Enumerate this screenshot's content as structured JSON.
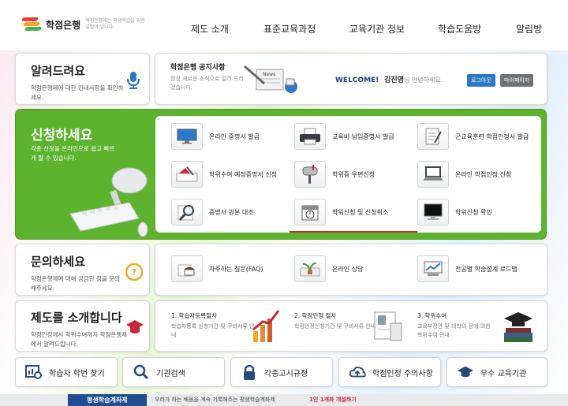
{
  "brand": {
    "name": "학점은행",
    "tagline": "학점은행제는 평생학습을 위한 길잡이 입니다."
  },
  "nav": [
    "제도 소개",
    "표준교육과정",
    "교육기관 정보",
    "학습도움방",
    "알림방"
  ],
  "notice_card": {
    "title": "알려드려요",
    "desc": "학점은행제에 대한 안내사항을 확인하세요."
  },
  "announce": {
    "title": "학점은행 공지사항",
    "desc": "항상 새로운 소식으로 알려 드리겠습니다.",
    "news_tag": "News"
  },
  "user": {
    "welcome": "WELCOME!",
    "name": "김진영",
    "suffix": "님 안녕하세요.",
    "logout": "로그아웃",
    "mypage": "마이페이지"
  },
  "apply": {
    "title": "신청하세요",
    "desc": "각종 신청을 온라인으로 쉽고 빠르게 할 수 있습니다.",
    "services": [
      {
        "label": "온라인 증명서 발급",
        "icon": "monitor-icon"
      },
      {
        "label": "교육비 납입증명서 발급",
        "icon": "printer-icon"
      },
      {
        "label": "군교육훈련 학점인정서 발급",
        "icon": "document-icon"
      },
      {
        "label": "학위수여 예정증명서 신청",
        "icon": "certificate-icon"
      },
      {
        "label": "학위증 우편신청",
        "icon": "mailbox-icon"
      },
      {
        "label": "온라인 학점인정 신청",
        "icon": "laptop-icon"
      },
      {
        "label": "증명서 원본 대조",
        "icon": "magnifier-icon"
      },
      {
        "label": "학위신청 및 신청취소",
        "icon": "calendar-icon"
      },
      {
        "label": "학위신청 확인",
        "icon": "monitor-check-icon"
      }
    ]
  },
  "ask": {
    "title": "문의하세요",
    "desc": "학점은행제에 대해 궁금한 점을 문의해주세요.",
    "items": [
      {
        "label": "자주하는 질문(FAQ)",
        "icon": "coffee-icon"
      },
      {
        "label": "온라인 상담",
        "icon": "plant-icon"
      },
      {
        "label": "전공별 학습설계 로드맵",
        "icon": "chart-screen-icon"
      }
    ]
  },
  "intro": {
    "title": "제도를 소개합니다",
    "desc": "학점인정에서 학위수여까지 학점은행제에서 알려드립니다.",
    "steps": [
      {
        "title": "1. 학습자등록절차",
        "desc": "학습자등록 신청기간 및 구비서류 안내"
      },
      {
        "title": "2. 학점인정 절차",
        "desc": "학점인정신청기간 및 구비서류 안내"
      },
      {
        "title": "3. 학위수여",
        "desc": "교육부장관 및 대학의 장에 의한 학위수여 안내"
      }
    ]
  },
  "quick": [
    "학습자 학번 찾기",
    "기관검색",
    "각종고시규정",
    "학점인정 주의사항",
    "우수 교육기관"
  ],
  "footer": {
    "left": "평생학습계좌제",
    "mid": "우리가 하는 배움을 계속 기록해주는 평생학습계좌제",
    "red": "1인 1계좌 개설하기"
  },
  "colors": {
    "green": "#5db32e",
    "blue": "#2a78c6",
    "red": "#c8283a"
  }
}
